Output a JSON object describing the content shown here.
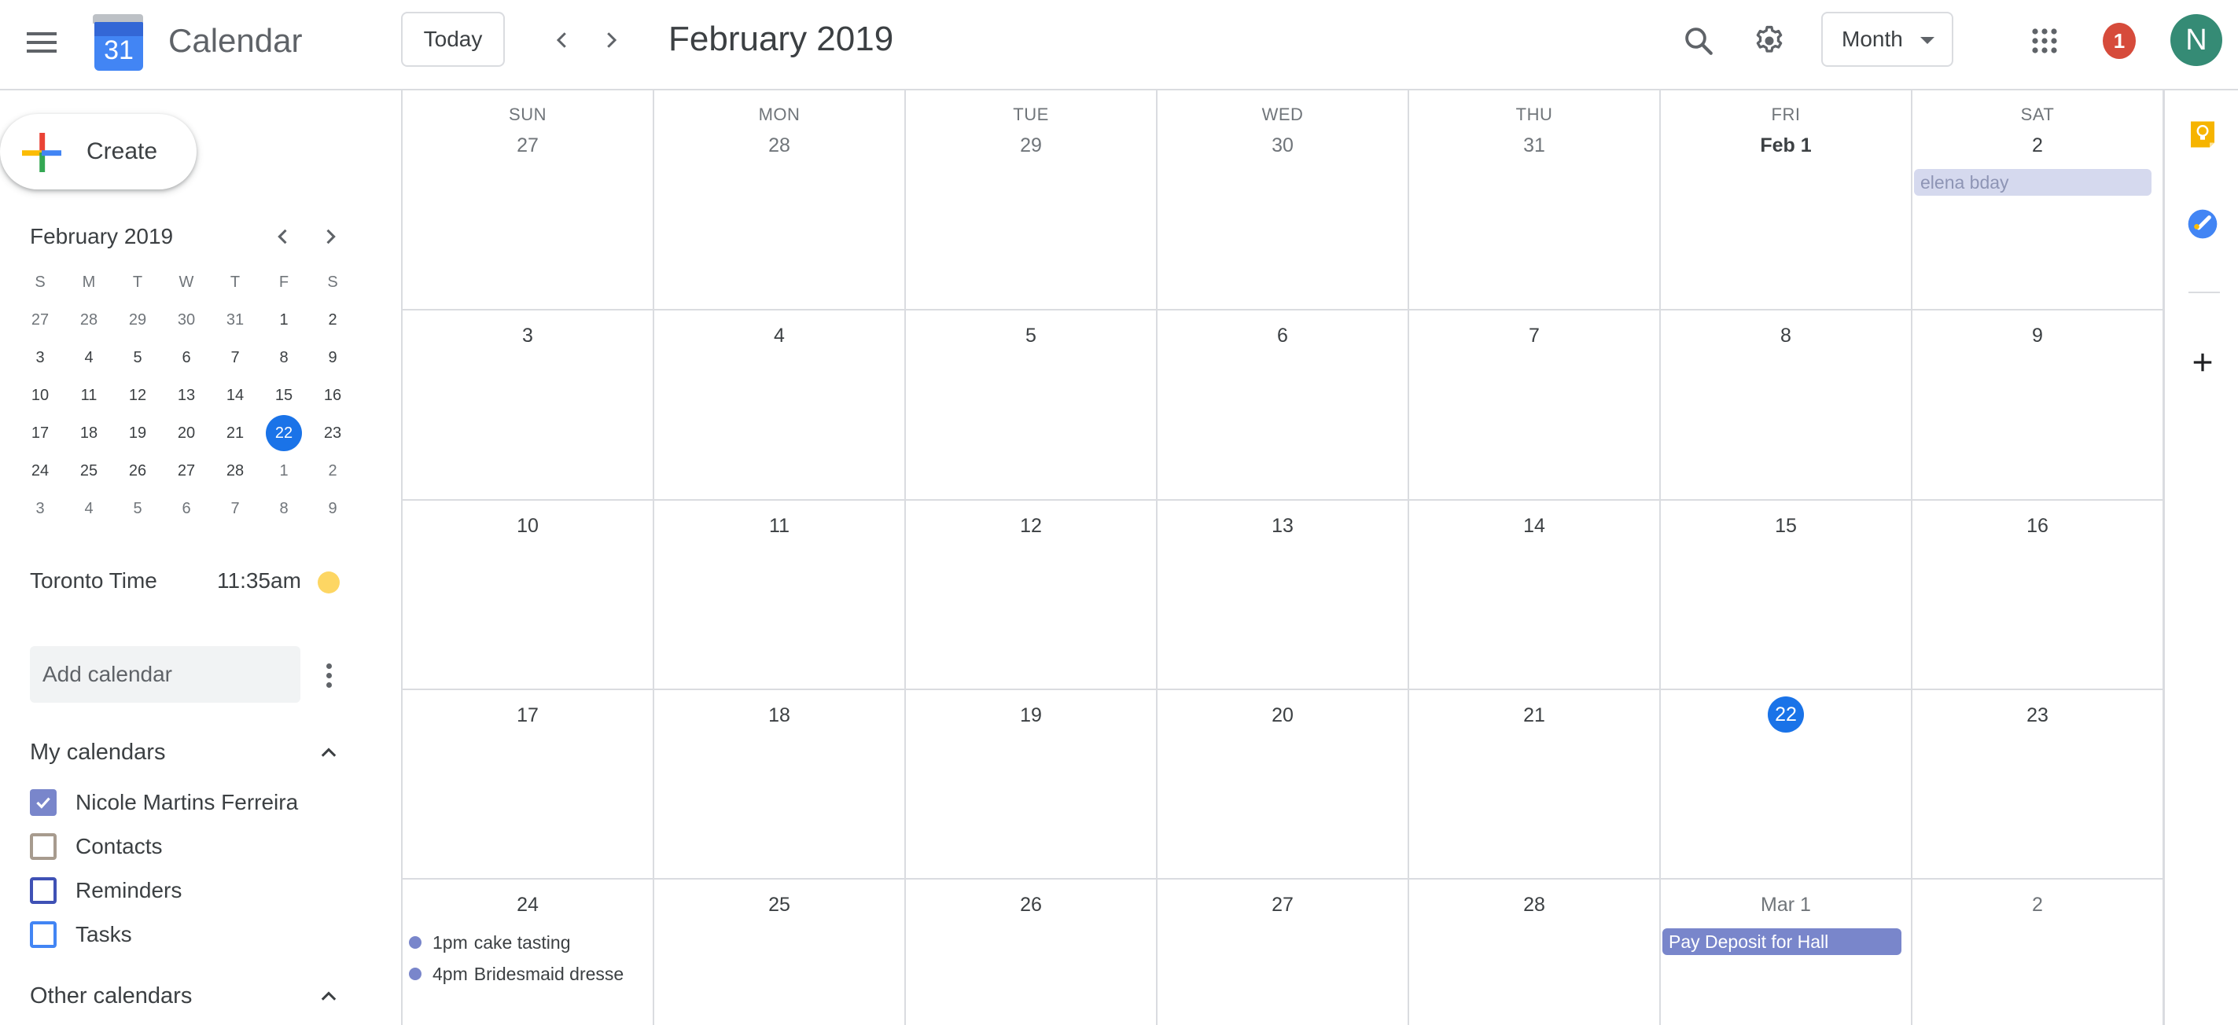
{
  "header": {
    "menu_icon": "hamburger-menu-icon",
    "logo_number": "31",
    "app_title": "Calendar",
    "today_label": "Today",
    "period_title": "February 2019",
    "view_selected": "Month",
    "notification_count": "1",
    "avatar_initial": "N"
  },
  "sidebar": {
    "create_label": "Create",
    "mini_calendar": {
      "title": "February 2019",
      "weekday_letters": [
        "S",
        "M",
        "T",
        "W",
        "T",
        "F",
        "S"
      ],
      "weeks": [
        [
          {
            "d": "27",
            "other": true
          },
          {
            "d": "28",
            "other": true
          },
          {
            "d": "29",
            "other": true
          },
          {
            "d": "30",
            "other": true
          },
          {
            "d": "31",
            "other": true
          },
          {
            "d": "1"
          },
          {
            "d": "2"
          }
        ],
        [
          {
            "d": "3"
          },
          {
            "d": "4"
          },
          {
            "d": "5"
          },
          {
            "d": "6"
          },
          {
            "d": "7"
          },
          {
            "d": "8"
          },
          {
            "d": "9"
          }
        ],
        [
          {
            "d": "10"
          },
          {
            "d": "11"
          },
          {
            "d": "12"
          },
          {
            "d": "13"
          },
          {
            "d": "14"
          },
          {
            "d": "15"
          },
          {
            "d": "16"
          }
        ],
        [
          {
            "d": "17"
          },
          {
            "d": "18"
          },
          {
            "d": "19"
          },
          {
            "d": "20"
          },
          {
            "d": "21"
          },
          {
            "d": "22",
            "today": true
          },
          {
            "d": "23"
          }
        ],
        [
          {
            "d": "24"
          },
          {
            "d": "25"
          },
          {
            "d": "26"
          },
          {
            "d": "27"
          },
          {
            "d": "28"
          },
          {
            "d": "1",
            "other": true
          },
          {
            "d": "2",
            "other": true
          }
        ],
        [
          {
            "d": "3",
            "other": true
          },
          {
            "d": "4",
            "other": true
          },
          {
            "d": "5",
            "other": true
          },
          {
            "d": "6",
            "other": true
          },
          {
            "d": "7",
            "other": true
          },
          {
            "d": "8",
            "other": true
          },
          {
            "d": "9",
            "other": true
          }
        ]
      ]
    },
    "timezone": {
      "label": "Toronto Time",
      "time": "11:35am"
    },
    "add_calendar_placeholder": "Add calendar",
    "my_calendars": {
      "title": "My calendars",
      "items": [
        {
          "label": "Nicole Martins Ferreira",
          "checked": true,
          "color": "#7986cb"
        },
        {
          "label": "Contacts",
          "checked": false,
          "color": "#a79b8e"
        },
        {
          "label": "Reminders",
          "checked": false,
          "color": "#3f51b5"
        },
        {
          "label": "Tasks",
          "checked": false,
          "color": "#4285f4"
        }
      ]
    },
    "other_calendars": {
      "title": "Other calendars"
    }
  },
  "month": {
    "weekdays": [
      "SUN",
      "MON",
      "TUE",
      "WED",
      "THU",
      "FRI",
      "SAT"
    ],
    "weeks": [
      [
        {
          "label": "27",
          "other": true
        },
        {
          "label": "28",
          "other": true
        },
        {
          "label": "29",
          "other": true
        },
        {
          "label": "30",
          "other": true
        },
        {
          "label": "31",
          "other": true
        },
        {
          "label": "Feb 1",
          "bold": true
        },
        {
          "label": "2"
        }
      ],
      [
        {
          "label": "3"
        },
        {
          "label": "4"
        },
        {
          "label": "5"
        },
        {
          "label": "6"
        },
        {
          "label": "7"
        },
        {
          "label": "8"
        },
        {
          "label": "9"
        }
      ],
      [
        {
          "label": "10"
        },
        {
          "label": "11"
        },
        {
          "label": "12"
        },
        {
          "label": "13"
        },
        {
          "label": "14"
        },
        {
          "label": "15"
        },
        {
          "label": "16"
        }
      ],
      [
        {
          "label": "17"
        },
        {
          "label": "18"
        },
        {
          "label": "19"
        },
        {
          "label": "20"
        },
        {
          "label": "21"
        },
        {
          "label": "22",
          "today": true
        },
        {
          "label": "23"
        }
      ],
      [
        {
          "label": "24"
        },
        {
          "label": "25"
        },
        {
          "label": "26"
        },
        {
          "label": "27"
        },
        {
          "label": "28"
        },
        {
          "label": "Mar 1",
          "other": true
        },
        {
          "label": "2",
          "other": true
        }
      ]
    ],
    "events": [
      {
        "week": 0,
        "day": 6,
        "type": "chip",
        "title": "elena bday",
        "bg": "#d5d9ee",
        "fg": "#8e95b5"
      },
      {
        "week": 4,
        "day": 0,
        "type": "dot",
        "time": "1pm",
        "title": "cake tasting",
        "color": "#7986cb"
      },
      {
        "week": 4,
        "day": 0,
        "type": "dot",
        "time": "4pm",
        "title": "Bridesmaid dresse",
        "color": "#7986cb"
      },
      {
        "week": 4,
        "day": 5,
        "type": "chip",
        "title": "Pay Deposit for Hall",
        "bg": "#7986cb",
        "fg": "#ffffff"
      }
    ]
  },
  "side_panel": {
    "items": [
      "keep-icon",
      "tasks-icon",
      "add-addon-icon"
    ]
  },
  "colors": {
    "accent": "#1a73e8",
    "calendar_primary": "#7986cb",
    "avatar": "#358b75",
    "badge": "#d64b3b"
  }
}
